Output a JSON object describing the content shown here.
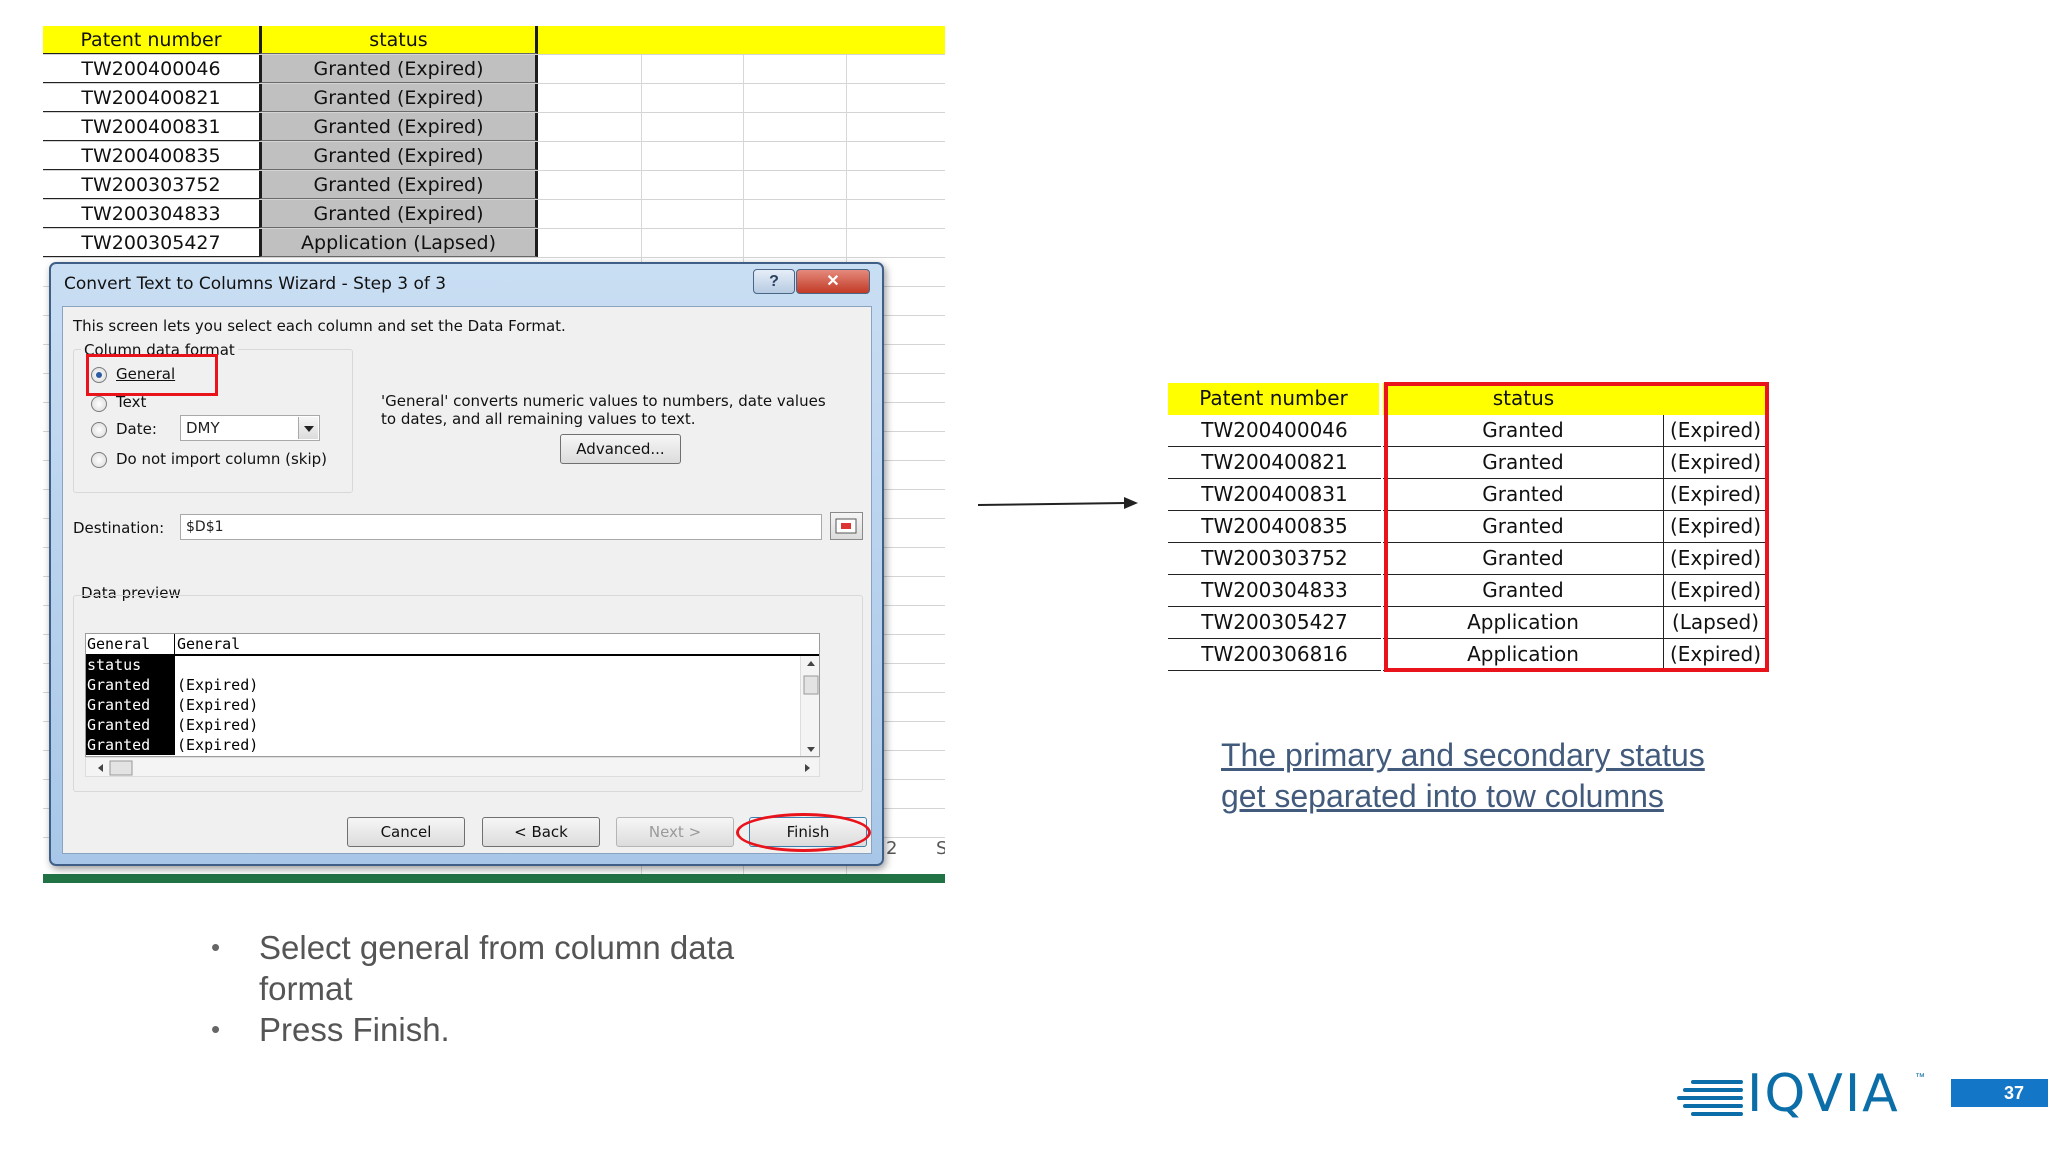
{
  "spreadsheet": {
    "headers": [
      "Patent number",
      "status"
    ],
    "rows": [
      [
        "TW200400046",
        "Granted (Expired)"
      ],
      [
        "TW200400821",
        "Granted (Expired)"
      ],
      [
        "TW200400831",
        "Granted (Expired)"
      ],
      [
        "TW200400835",
        "Granted (Expired)"
      ],
      [
        "TW200303752",
        "Granted (Expired)"
      ],
      [
        "TW200304833",
        "Granted (Expired)"
      ],
      [
        "TW200305427",
        "Application (Lapsed)"
      ]
    ],
    "tab_fragment_1": "2",
    "tab_fragment_2": "S"
  },
  "dialog": {
    "title": "Convert Text to Columns Wizard - Step 3 of 3",
    "help_label": "?",
    "close_label": "✕",
    "intro": "This screen lets you select each column and set the Data Format.",
    "group_label": "Column data format",
    "options": {
      "general": "General",
      "text": "Text",
      "date": "Date:",
      "skip": "Do not import column (skip)"
    },
    "date_format": "DMY",
    "description_line1": "'General' converts numeric values to numbers, date values",
    "description_line2": "to dates, and all remaining values to text.",
    "advanced_label": "Advanced...",
    "destination_label": "Destination:",
    "destination_value": "$D$1",
    "preview_label": "Data preview",
    "preview": {
      "headers": [
        "General",
        "General"
      ],
      "rows": [
        [
          "status",
          ""
        ],
        [
          "Granted",
          "(Expired)"
        ],
        [
          "Granted",
          "(Expired)"
        ],
        [
          "Granted",
          "(Expired)"
        ],
        [
          "Granted",
          "(Expired)"
        ]
      ]
    },
    "buttons": {
      "cancel": "Cancel",
      "back": "< Back",
      "next": "Next >",
      "finish": "Finish"
    }
  },
  "result_table": {
    "headers": [
      "Patent number",
      "status",
      ""
    ],
    "rows": [
      [
        "TW200400046",
        "Granted",
        "(Expired)"
      ],
      [
        "TW200400821",
        "Granted",
        "(Expired)"
      ],
      [
        "TW200400831",
        "Granted",
        "(Expired)"
      ],
      [
        "TW200400835",
        "Granted",
        "(Expired)"
      ],
      [
        "TW200303752",
        "Granted",
        "(Expired)"
      ],
      [
        "TW200304833",
        "Granted",
        "(Expired)"
      ],
      [
        "TW200305427",
        "Application",
        "(Lapsed)"
      ],
      [
        "TW200306816",
        "Application",
        "(Expired)"
      ]
    ]
  },
  "caption": "The primary and secondary status get separated into tow columns",
  "instructions": [
    "Select general from column data format",
    "Press Finish."
  ],
  "footer": {
    "logo_text": "IQVIA",
    "logo_tm": "™",
    "page_number": "37"
  },
  "colors": {
    "header_yellow": "#ffff00",
    "highlight_red": "#e8131b",
    "caption_blue": "#425b7c",
    "brand_blue": "#0b6ea8",
    "page_badge_blue": "#1476c6",
    "excel_green": "#217346"
  }
}
